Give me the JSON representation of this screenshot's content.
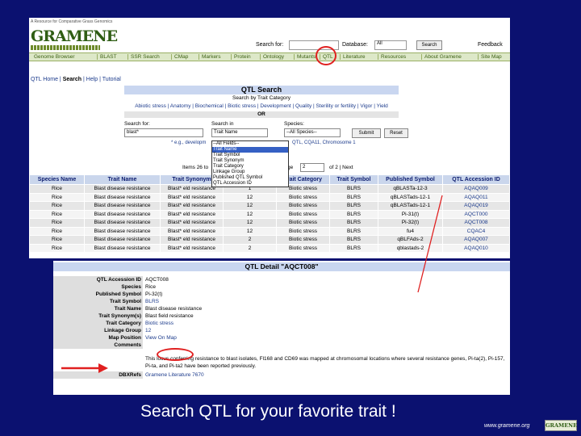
{
  "header": {
    "tagline": "A Resource for Comparative Grass Genomics",
    "logo": "GRAMENE",
    "search_label": "Search for:",
    "database_label": "Database:",
    "database_value": "All",
    "search_button": "Search",
    "feedback": "Feedback"
  },
  "nav": [
    "Genome Browser",
    "BLAST",
    "SSR Search",
    "CMap",
    "Markers",
    "Protein",
    "Ontology",
    "Mutants",
    "QTL",
    "Literature",
    "Resources",
    "About Gramene",
    "Site Map"
  ],
  "breadcrumb": {
    "home": "QTL Home",
    "search": "Search",
    "help": "Help",
    "tutorial": "Tutorial"
  },
  "qtl_search": {
    "title": "QTL Search",
    "subtitle": "Search by Trait Category",
    "categories": "Abiotic stress | Anatomy | Biochemical | Biotic stress | Development | Quality | Sterility or fertility | Vigor | Yield",
    "or": "OR",
    "search_for_label": "Search for:",
    "search_for_value": "blast*",
    "search_in_label": "Search in",
    "search_in_value": "Trait Name",
    "species_label": "Species:",
    "species_value": "--All Species--",
    "submit": "Submit",
    "reset": "Reset",
    "example_prefix": "* e.g., developm",
    "example_suffix": "QTL, CQA11, Chromosome 1",
    "dropdown_options": [
      "--All Fields--",
      "Trait Name",
      "Trait Symbol",
      "Trait Synonym",
      "Trait Category",
      "Linkage Group",
      "Published QTL Symbol",
      "QTL Accession ID"
    ],
    "dropdown_selected": 1,
    "items_label": "Items 26 to",
    "page_label": "Page",
    "page_value": "2",
    "of_pages": "of 2 | Next"
  },
  "results": {
    "headers": [
      "Species Name",
      "Trait Name",
      "Trait Synonym",
      "",
      "Trait Category",
      "Trait Symbol",
      "Published Symbol",
      "QTL Accession ID"
    ],
    "rows": [
      [
        "Rice",
        "Blast disease resistance",
        "Blast* eld resistance",
        "1",
        "Biotic stress",
        "BLRS",
        "qBLASTa-12-3",
        "AQAQ009"
      ],
      [
        "Rice",
        "Blast disease resistance",
        "Blast* eld resistance",
        "12",
        "Biotic stress",
        "BLRS",
        "qBLASTads-12-1",
        "AQAQ011"
      ],
      [
        "Rice",
        "Blast disease resistance",
        "Blast* eld resistance",
        "12",
        "Biotic stress",
        "BLRS",
        "qBLASTads-12-1",
        "AQAQ019"
      ],
      [
        "Rice",
        "Blast disease resistance",
        "Blast* eld resistance",
        "12",
        "Biotic stress",
        "BLRS",
        "Pi-31(t)",
        "AQCT000"
      ],
      [
        "Rice",
        "Blast disease resistance",
        "Blast* eld resistance",
        "12",
        "Biotic stress",
        "BLRS",
        "Pi-32(t)",
        "AQCT008"
      ],
      [
        "Rice",
        "Blast disease resistance",
        "Blast* eld resistance",
        "12",
        "Biotic stress",
        "BLRS",
        "fu4",
        "CQAC4"
      ],
      [
        "Rice",
        "Blast disease resistance",
        "Blast* eld resistance",
        "2",
        "Biotic stress",
        "BLRS",
        "qBLFAds-2",
        "AQAQ007"
      ],
      [
        "Rice",
        "Blast disease resistance",
        "Blast* eld resistance",
        "2",
        "Biotic stress",
        "BLRS",
        "qblastads-2",
        "AQAQ010"
      ]
    ]
  },
  "qtl_detail": {
    "title": "QTL Detail \"AQCT008\"",
    "rows": [
      {
        "label": "QTL Accession ID",
        "value": "AQCT008",
        "link": false
      },
      {
        "label": "Species",
        "value": "Rice",
        "link": false
      },
      {
        "label": "Published Symbol",
        "value": "Pi-32(t)",
        "link": false
      },
      {
        "label": "Trait Symbol",
        "value": "BLRS",
        "link": true
      },
      {
        "label": "Trait Name",
        "value": "Blast disease resistance",
        "link": false
      },
      {
        "label": "Trait Synonym(s)",
        "value": "Blast field resistance",
        "link": false
      },
      {
        "label": "Trait Category",
        "value": "Biotic stress",
        "link": true
      },
      {
        "label": "Linkage Group",
        "value": "12",
        "link": true
      },
      {
        "label": "Map Position",
        "value": "View On Map",
        "link": true
      },
      {
        "label": "Comments",
        "value": "",
        "link": false
      },
      {
        "label": "DBXRefs",
        "value": "Gramene Literature 7670",
        "link": true
      }
    ],
    "comment_text": "This locus conferring resistance to blast isolates, Fl168 and CD69 was mapped at chromosomal locations where several resistance genes, Pi-ta(2), Pi-157, Pi-ta, and Pi-ta2 have been reported previously."
  },
  "caption": "Search QTL for your favorite trait !",
  "footer": {
    "url": "www.gramene.org",
    "logo": "GRAMENE"
  },
  "colors": {
    "slide_bg": "#0b1170",
    "callout": "#e02020",
    "nav_text": "#3b5f12",
    "link": "#1c3b8c"
  }
}
